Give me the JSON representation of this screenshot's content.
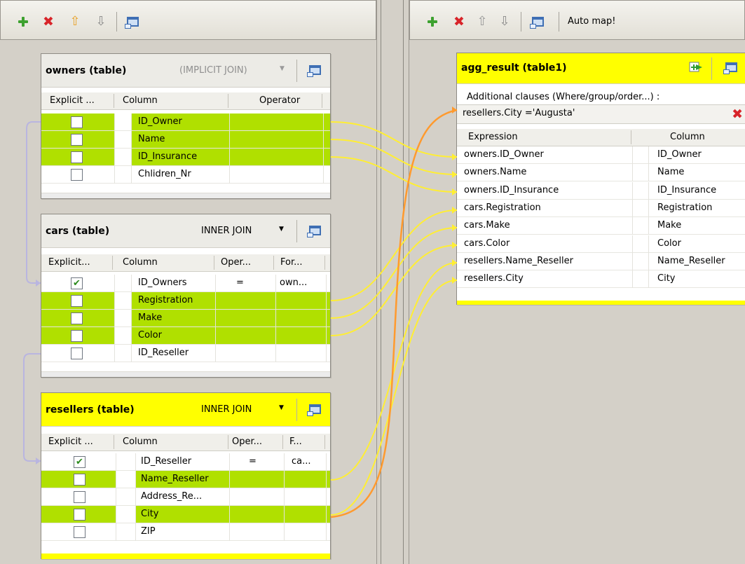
{
  "left_toolbar": {
    "icons": [
      "add-icon",
      "delete-icon",
      "move-up-icon",
      "move-down-icon",
      "window-icon"
    ]
  },
  "right_toolbar": {
    "icons": [
      "add-icon",
      "delete-icon",
      "move-up-icon",
      "move-down-icon",
      "window-icon"
    ],
    "auto_map_label": "Auto map!"
  },
  "owners": {
    "title": "owners (table)",
    "join": "(IMPLICIT JOIN)",
    "headers": {
      "explicit": "Explicit ...",
      "column": "Column",
      "operator": "Operator"
    },
    "rows": [
      {
        "column": "ID_Owner",
        "checked": false,
        "highlighted": true
      },
      {
        "column": "Name",
        "checked": false,
        "highlighted": true
      },
      {
        "column": "ID_Insurance",
        "checked": false,
        "highlighted": true
      },
      {
        "column": "Chlidren_Nr",
        "checked": false,
        "highlighted": false
      }
    ]
  },
  "cars": {
    "title": "cars (table)",
    "join": "INNER JOIN",
    "headers": {
      "explicit": "Explicit...",
      "column": "Column",
      "operator": "Oper...",
      "formula": "For..."
    },
    "rows": [
      {
        "column": "ID_Owners",
        "checked": true,
        "highlighted": false,
        "operator": "=",
        "formula": "own..."
      },
      {
        "column": "Registration",
        "checked": false,
        "highlighted": true,
        "operator": "",
        "formula": ""
      },
      {
        "column": "Make",
        "checked": false,
        "highlighted": true,
        "operator": "",
        "formula": ""
      },
      {
        "column": "Color",
        "checked": false,
        "highlighted": true,
        "operator": "",
        "formula": ""
      },
      {
        "column": "ID_Reseller",
        "checked": false,
        "highlighted": false,
        "operator": "",
        "formula": ""
      }
    ]
  },
  "resellers": {
    "title": "resellers (table)",
    "join": "INNER JOIN",
    "headers": {
      "explicit": "Explicit ...",
      "column": "Column",
      "operator": "Oper...",
      "formula": "F..."
    },
    "rows": [
      {
        "column": "ID_Reseller",
        "checked": true,
        "highlighted": false,
        "operator": "=",
        "formula": "ca..."
      },
      {
        "column": "Name_Reseller",
        "checked": false,
        "highlighted": true,
        "operator": "",
        "formula": ""
      },
      {
        "column": "Address_Re...",
        "checked": false,
        "highlighted": false,
        "operator": "",
        "formula": ""
      },
      {
        "column": "City",
        "checked": false,
        "highlighted": true,
        "operator": "",
        "formula": ""
      },
      {
        "column": "ZIP",
        "checked": false,
        "highlighted": false,
        "operator": "",
        "formula": ""
      }
    ]
  },
  "agg_result": {
    "title": "agg_result (table1)",
    "clauses_label": "Additional clauses (Where/group/order...) :",
    "clause": "resellers.City ='Augusta'",
    "headers": {
      "expression": "Expression",
      "column": "Column"
    },
    "rows": [
      {
        "expression": "owners.ID_Owner",
        "column": "ID_Owner"
      },
      {
        "expression": "owners.Name",
        "column": "Name"
      },
      {
        "expression": "owners.ID_Insurance",
        "column": "ID_Insurance"
      },
      {
        "expression": "cars.Registration",
        "column": "Registration"
      },
      {
        "expression": "cars.Make",
        "column": "Make"
      },
      {
        "expression": "cars.Color",
        "column": "Color"
      },
      {
        "expression": "resellers.Name_Reseller",
        "column": "Name_Reseller"
      },
      {
        "expression": "resellers.City",
        "column": "City"
      }
    ]
  },
  "colors": {
    "highlight_green": "#b0e000",
    "yellow": "#ffff00",
    "link_yellow": "#ffee33",
    "link_orange": "#ff9a2e",
    "join_link": "#b9b5e0"
  }
}
